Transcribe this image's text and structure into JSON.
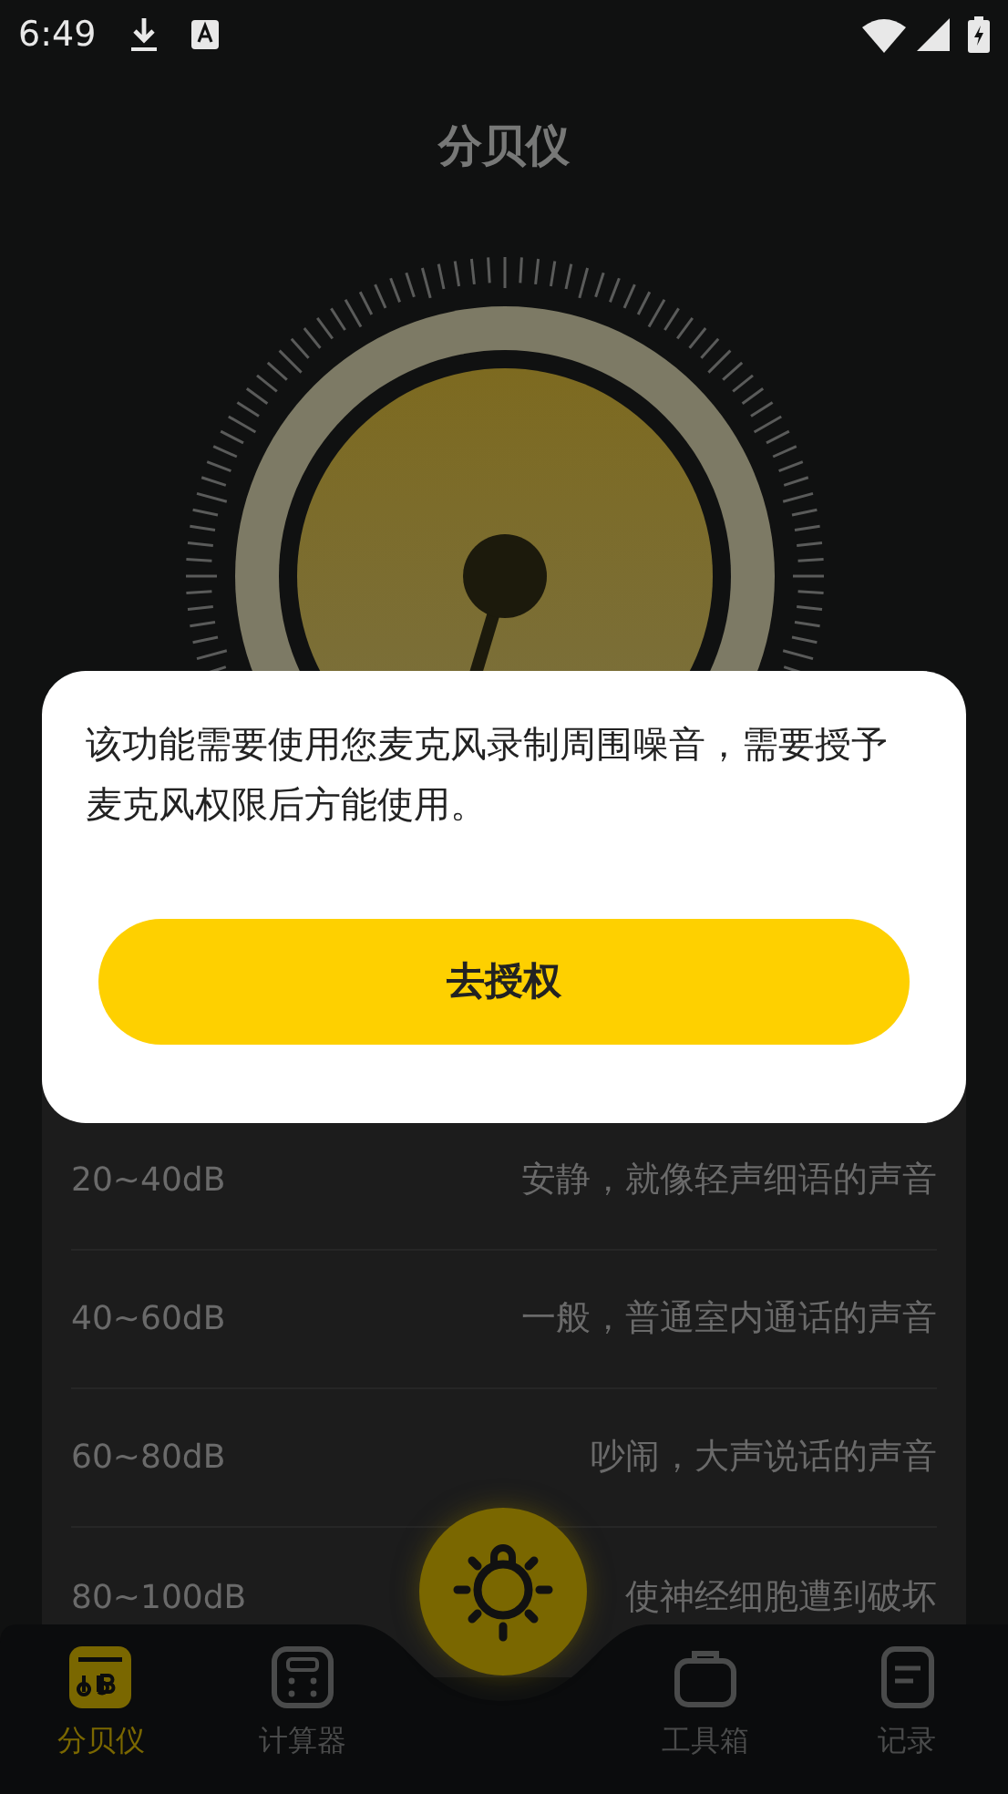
{
  "status_bar": {
    "time": "6:49"
  },
  "title": "分贝仪",
  "levels": [
    {
      "range": "20~40dB",
      "description": "安静，就像轻声细语的声音"
    },
    {
      "range": "40~60dB",
      "description": "一般，普通室内通话的声音"
    },
    {
      "range": "60~80dB",
      "description": "吵闹，大声说话的声音"
    },
    {
      "range": "80~100dB",
      "description": "使神经细胞遭到破坏"
    }
  ],
  "dialog": {
    "message": "该功能需要使用您麦克风录制周围噪音，需要授予麦克风权限后方能使用。",
    "button": "去授权"
  },
  "nav": [
    {
      "label": "分贝仪",
      "kind": "meter",
      "selected": true
    },
    {
      "label": "计算器",
      "kind": "calculator",
      "selected": false
    },
    {
      "label": "工具箱",
      "kind": "toolbox",
      "selected": false
    },
    {
      "label": "记录",
      "kind": "record",
      "selected": false
    }
  ]
}
